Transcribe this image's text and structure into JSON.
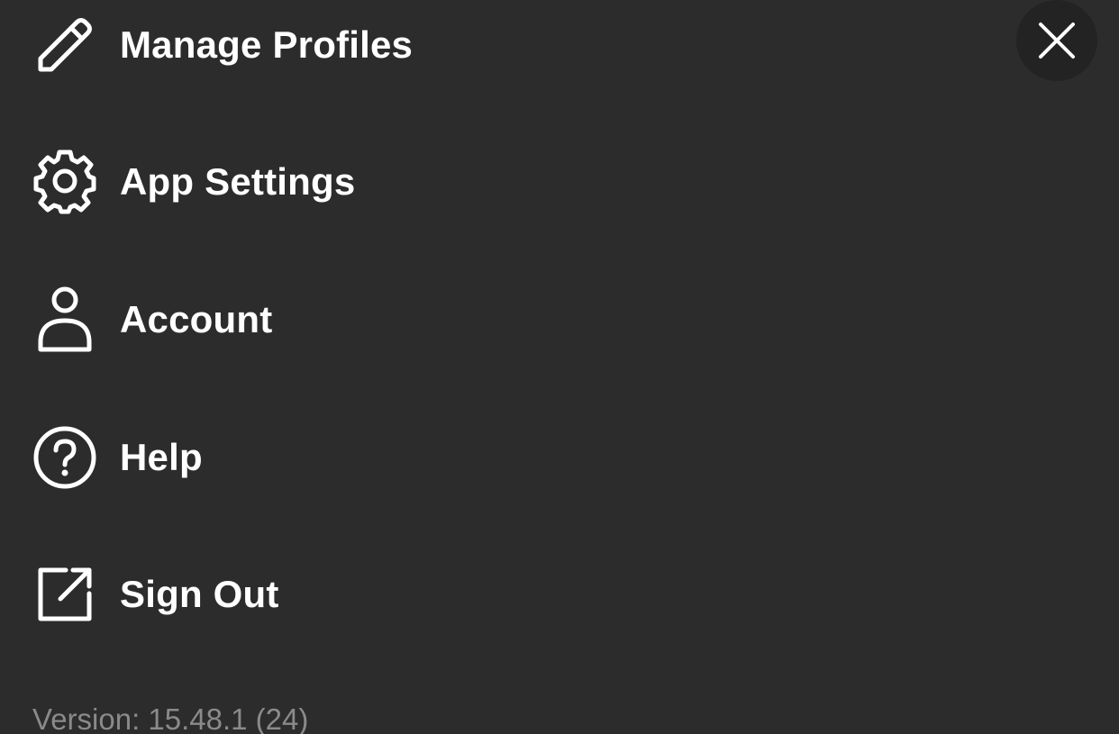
{
  "menu": {
    "items": [
      {
        "label": "Manage Profiles",
        "icon": "pencil-icon"
      },
      {
        "label": "App Settings",
        "icon": "gear-icon"
      },
      {
        "label": "Account",
        "icon": "person-icon"
      },
      {
        "label": "Help",
        "icon": "question-circle-icon"
      },
      {
        "label": "Sign Out",
        "icon": "external-link-icon"
      }
    ]
  },
  "close": {
    "icon": "close-icon"
  },
  "footer": {
    "version": "Version: 15.48.1 (24)"
  },
  "colors": {
    "background": "#2c2c2c",
    "close_button_bg": "#232323",
    "text": "#ffffff",
    "muted_text": "#8a8a8a"
  }
}
